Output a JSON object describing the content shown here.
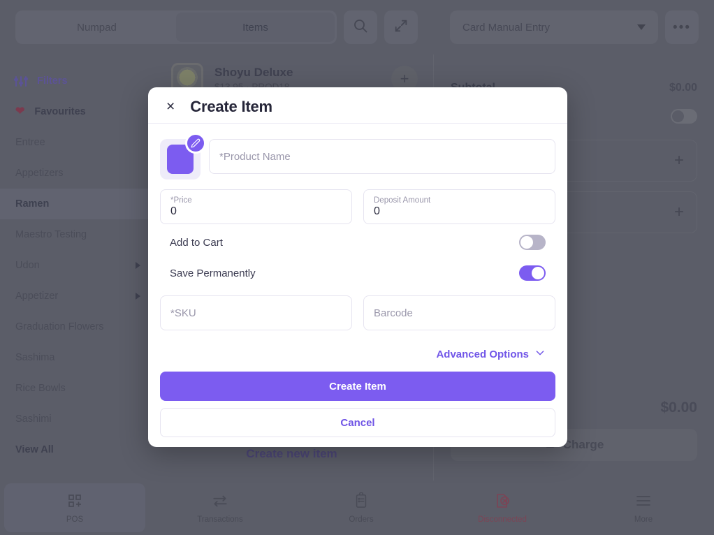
{
  "topbar": {
    "tabs": [
      {
        "label": "Numpad",
        "active": false
      },
      {
        "label": "Items",
        "active": true
      }
    ],
    "search_icon": "search-icon",
    "expand_icon": "expand-icon",
    "payment_method": "Card Manual Entry",
    "more_label": "•••"
  },
  "sidebar": {
    "filters_label": "Filters",
    "favourites_label": "Favourites",
    "categories": [
      {
        "label": "Entree",
        "has_arrow": false,
        "selected": false
      },
      {
        "label": "Appetizers",
        "has_arrow": false,
        "selected": false
      },
      {
        "label": "Ramen",
        "has_arrow": false,
        "selected": true
      },
      {
        "label": "Maestro Testing",
        "has_arrow": false,
        "selected": false
      },
      {
        "label": "Udon",
        "has_arrow": true,
        "selected": false
      },
      {
        "label": "Appetizer",
        "has_arrow": true,
        "selected": false
      },
      {
        "label": "Graduation Flowers",
        "has_arrow": false,
        "selected": false
      },
      {
        "label": "Sashima",
        "has_arrow": false,
        "selected": false
      },
      {
        "label": "Rice Bowls",
        "has_arrow": false,
        "selected": false
      },
      {
        "label": "Sashimi",
        "has_arrow": false,
        "selected": false
      }
    ],
    "view_all_label": "View All"
  },
  "centre": {
    "product": {
      "name": "Shoyu Deluxe",
      "price": "$13.95",
      "separator": "·",
      "sku": "PROD18",
      "add_label": "+"
    },
    "create_new_label": "Create new item"
  },
  "cart": {
    "subtotal_label": "Subtotal",
    "subtotal_value": "$0.00",
    "add_plus_1": "+",
    "add_plus_2": "+",
    "total_value": "$0.00",
    "charge_label": "Charge"
  },
  "bottom_nav": [
    {
      "label": "POS",
      "icon": "pos-icon",
      "active": true,
      "alert": false
    },
    {
      "label": "Transactions",
      "icon": "transactions-icon",
      "active": false,
      "alert": false
    },
    {
      "label": "Orders",
      "icon": "orders-icon",
      "active": false,
      "alert": false
    },
    {
      "label": "Disconnected",
      "icon": "disconnected-icon",
      "active": false,
      "alert": true
    },
    {
      "label": "More",
      "icon": "more-icon",
      "active": false,
      "alert": false
    }
  ],
  "modal": {
    "title": "Create Item",
    "close_label": "×",
    "image_edit_icon": "pencil-icon",
    "product_name_placeholder": "*Product Name",
    "price_label": "*Price",
    "price_value": "0",
    "deposit_label": "Deposit Amount",
    "deposit_value": "0",
    "add_to_cart_label": "Add to Cart",
    "add_to_cart_state": "off",
    "save_permanently_label": "Save Permanently",
    "save_permanently_state": "on",
    "sku_placeholder": "*SKU",
    "barcode_placeholder": "Barcode",
    "advanced_options_label": "Advanced Options",
    "advanced_options_icon": "chevron-down-icon",
    "create_button_label": "Create Item",
    "cancel_button_label": "Cancel"
  },
  "colors": {
    "accent": "#7c5cf0",
    "accent_text": "#6f54e5",
    "modal_bg": "#ffffff",
    "app_bg": "#5b5d68",
    "alert": "#7c4455"
  }
}
